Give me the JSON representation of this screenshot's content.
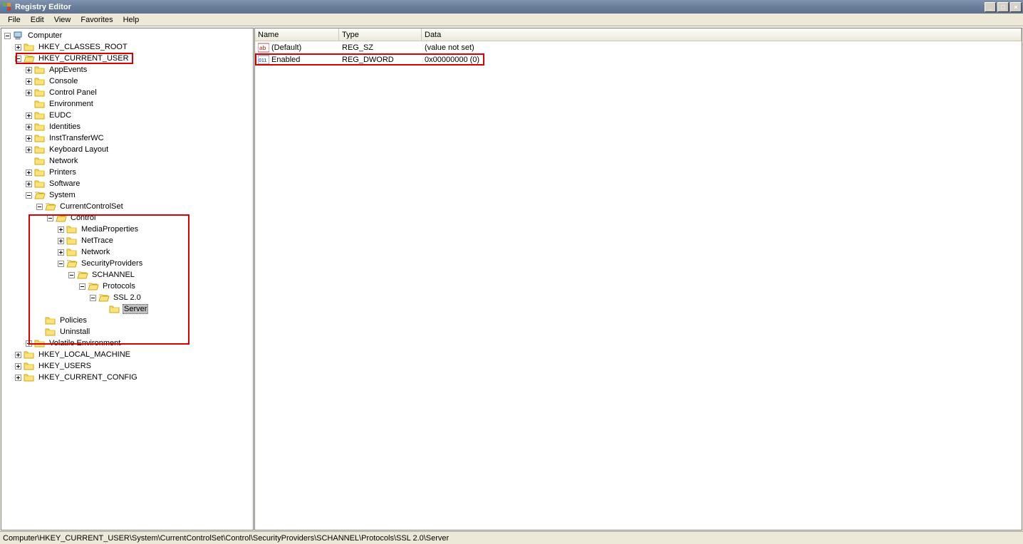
{
  "title": "Registry Editor",
  "menu": [
    "File",
    "Edit",
    "View",
    "Favorites",
    "Help"
  ],
  "tree": {
    "root": "Computer",
    "hkcr": "HKEY_CLASSES_ROOT",
    "hkcu": "HKEY_CURRENT_USER",
    "hklm": "HKEY_LOCAL_MACHINE",
    "hku": "HKEY_USERS",
    "hkcc": "HKEY_CURRENT_CONFIG",
    "hkcu_children": {
      "appevents": "AppEvents",
      "console": "Console",
      "controlpanel": "Control Panel",
      "environment": "Environment",
      "eudc": "EUDC",
      "identities": "Identities",
      "insttransferwc": "InstTransferWC",
      "keyboardlayout": "Keyboard Layout",
      "network": "Network",
      "printers": "Printers",
      "software": "Software",
      "system": "System",
      "policies": "Policies",
      "uninstall": "Uninstall",
      "volatileenv": "Volatile Environment"
    },
    "system": {
      "ccs": "CurrentControlSet",
      "control": "Control",
      "mediaproperties": "MediaProperties",
      "nettrace": "NetTrace",
      "network2": "Network",
      "securityproviders": "SecurityProviders",
      "schannel": "SCHANNEL",
      "protocols": "Protocols",
      "ssl20": "SSL 2.0",
      "server": "Server"
    }
  },
  "columns": {
    "name": "Name",
    "type": "Type",
    "data": "Data"
  },
  "values": [
    {
      "icon": "string",
      "name": "(Default)",
      "type": "REG_SZ",
      "data": "(value not set)"
    },
    {
      "icon": "dword",
      "name": "Enabled",
      "type": "REG_DWORD",
      "data": "0x00000000 (0)"
    }
  ],
  "statuspath": "Computer\\HKEY_CURRENT_USER\\System\\CurrentControlSet\\Control\\SecurityProviders\\SCHANNEL\\Protocols\\SSL 2.0\\Server"
}
